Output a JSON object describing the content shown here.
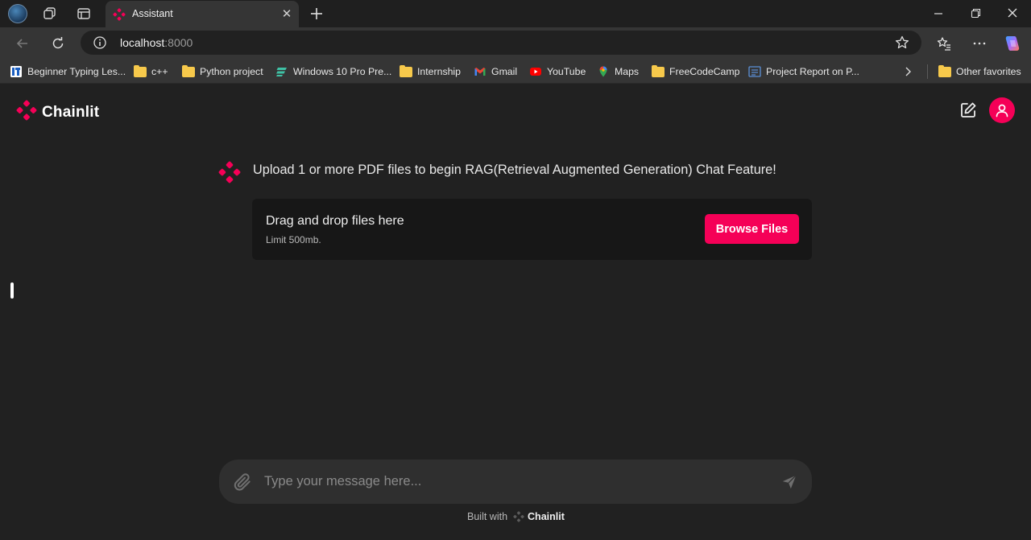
{
  "browser": {
    "tab_title": "Assistant",
    "url_host": "localhost",
    "url_port": ":8000",
    "bookmarks": [
      {
        "label": "Beginner Typing Les...",
        "icon": "typing-icon"
      },
      {
        "label": "c++",
        "icon": "folder-icon"
      },
      {
        "label": "Python project",
        "icon": "folder-icon"
      },
      {
        "label": "Windows 10 Pro Pre...",
        "icon": "windows-icon"
      },
      {
        "label": "Internship",
        "icon": "folder-icon"
      },
      {
        "label": "Gmail",
        "icon": "gmail-icon"
      },
      {
        "label": "YouTube",
        "icon": "youtube-icon"
      },
      {
        "label": "Maps",
        "icon": "maps-icon"
      },
      {
        "label": "FreeCodeCamp",
        "icon": "folder-icon"
      },
      {
        "label": "Project Report on P...",
        "icon": "report-icon"
      }
    ],
    "other_favorites": "Other favorites"
  },
  "app": {
    "brand": "Chainlit",
    "accent": "#f50057",
    "message": "Upload 1 or more PDF files to begin RAG(Retrieval Augmented Generation) Chat Feature!",
    "dropzone": {
      "title": "Drag and drop files here",
      "limit": "Limit 500mb.",
      "button": "Browse Files"
    },
    "composer": {
      "placeholder": "Type your message here..."
    },
    "footer": {
      "prefix": "Built with",
      "brand": "Chainlit"
    }
  }
}
